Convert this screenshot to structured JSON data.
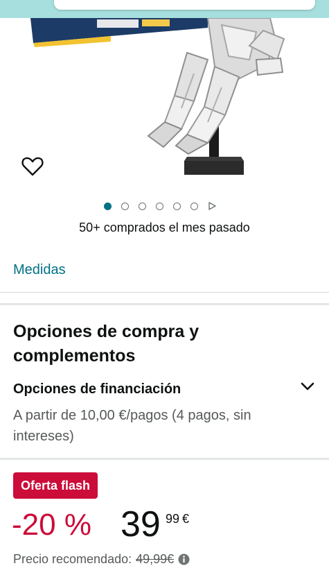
{
  "product": {
    "wishlist_icon": "heart-icon",
    "carousel": {
      "total_images": 6,
      "active_index": 0,
      "next_icon": "play-triangle-icon"
    },
    "bought_text": "50+ comprados el mes pasado",
    "medidas_link": "Medidas"
  },
  "purchase_options": {
    "title": "Opciones de compra y complementos",
    "financing": {
      "title": "Opciones de financiación",
      "description": "A partir de 10,00 €/pagos (4 pagos, sin intereses)",
      "expand_icon": "chevron-down-icon"
    }
  },
  "offer": {
    "badge": "Oferta flash",
    "discount": "-20 %",
    "price_whole": "39",
    "price_fraction": "99",
    "currency": "€",
    "recommended_label": "Precio recomendado:",
    "recommended_price": "49,99€",
    "info_icon": "info-icon"
  },
  "colors": {
    "link": "#007185",
    "deal_red": "#cc0c39",
    "top_bar": "#a7dede"
  }
}
